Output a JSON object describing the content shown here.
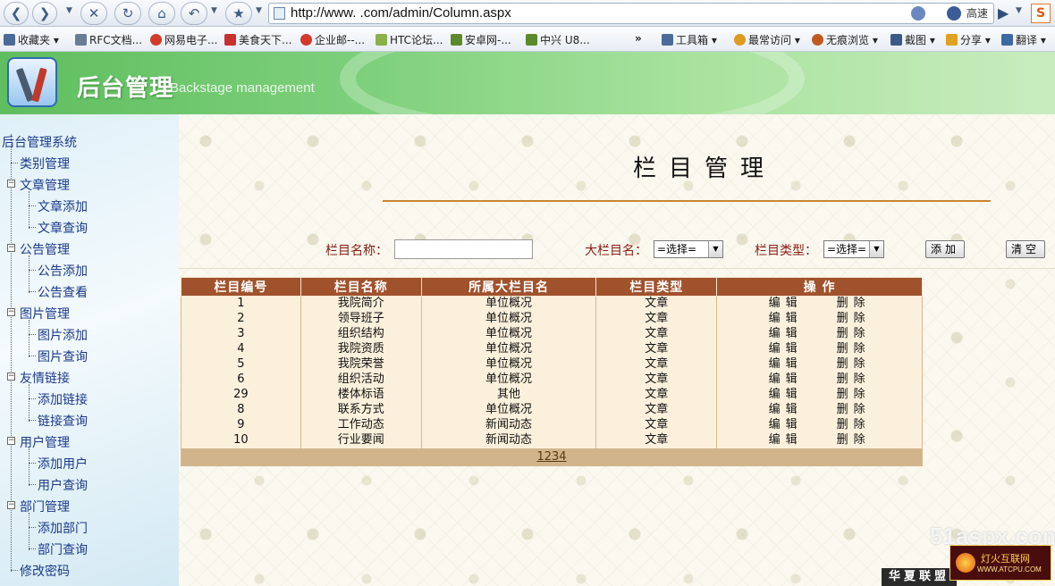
{
  "browser": {
    "url": "http://www.          .com/admin/Column.aspx",
    "speed_label": "高速",
    "bookmarks": [
      {
        "label": "收藏夹",
        "color": "#4a6a9a"
      },
      {
        "label": "RFC文档...",
        "color": "#6a7c94"
      },
      {
        "label": "网易电子...",
        "color": "#d23a2a"
      },
      {
        "label": "美食天下...",
        "color": "#c83030"
      },
      {
        "label": "企业邮--...",
        "color": "#d23a2a"
      },
      {
        "label": "HTC论坛...",
        "color": "#8ab04a"
      },
      {
        "label": "安卓网-...",
        "color": "#5b8a2a"
      },
      {
        "label": "中兴 U8...",
        "color": "#5b8a2a"
      },
      {
        "label": "工具箱",
        "color": "#4a6a9a"
      },
      {
        "label": "最常访问",
        "color": "#e09a20"
      },
      {
        "label": "无痕浏览",
        "color": "#c05a20"
      },
      {
        "label": "截图",
        "color": "#3a5a8a"
      },
      {
        "label": "分享",
        "color": "#e0a020"
      },
      {
        "label": "翻译",
        "color": "#3a6aa0"
      }
    ],
    "overflow_label": "»"
  },
  "banner": {
    "title": "后台管理",
    "subtitle": "Backstage management"
  },
  "sidebar": {
    "root": "后台管理系统",
    "items": [
      {
        "label": "类别管理",
        "level": 1
      },
      {
        "label": "文章管理",
        "level": 1,
        "expand": true
      },
      {
        "label": "文章添加",
        "level": 2
      },
      {
        "label": "文章查询",
        "level": 2
      },
      {
        "label": "公告管理",
        "level": 1,
        "expand": true
      },
      {
        "label": "公告添加",
        "level": 2
      },
      {
        "label": "公告查看",
        "level": 2
      },
      {
        "label": "图片管理",
        "level": 1,
        "expand": true
      },
      {
        "label": "图片添加",
        "level": 2
      },
      {
        "label": "图片查询",
        "level": 2
      },
      {
        "label": "友情链接",
        "level": 1,
        "expand": true
      },
      {
        "label": "添加链接",
        "level": 2
      },
      {
        "label": "链接查询",
        "level": 2
      },
      {
        "label": "用户管理",
        "level": 1,
        "expand": true
      },
      {
        "label": "添加用户",
        "level": 2
      },
      {
        "label": "用户查询",
        "level": 2
      },
      {
        "label": "部门管理",
        "level": 1,
        "expand": true
      },
      {
        "label": "添加部门",
        "level": 2
      },
      {
        "label": "部门查询",
        "level": 2
      },
      {
        "label": "修改密码",
        "level": 1
      }
    ]
  },
  "main": {
    "title": "栏目管理",
    "form": {
      "name_label": "栏目名称：",
      "name_value": "",
      "parent_label": "大栏目名：",
      "parent_value": "=选择=",
      "type_label": "栏目类型：",
      "type_value": "=选择=",
      "add_button": "添加",
      "clear_button": "清空"
    },
    "table": {
      "headers": [
        "栏目编号",
        "栏目名称",
        "所属大栏目名",
        "栏目类型",
        "操 作"
      ],
      "edit_label": "编辑",
      "delete_label": "删除",
      "rows": [
        [
          "1",
          "我院简介",
          "单位概况",
          "文章"
        ],
        [
          "2",
          "领导班子",
          "单位概况",
          "文章"
        ],
        [
          "3",
          "组织结构",
          "单位概况",
          "文章"
        ],
        [
          "4",
          "我院资质",
          "单位概况",
          "文章"
        ],
        [
          "5",
          "我院荣誉",
          "单位概况",
          "文章"
        ],
        [
          "6",
          "组织活动",
          "单位概况",
          "文章"
        ],
        [
          "29",
          "楼体标语",
          "其他",
          "文章"
        ],
        [
          "8",
          "联系方式",
          "单位概况",
          "文章"
        ],
        [
          "9",
          "工作动态",
          "新闻动态",
          "文章"
        ],
        [
          "10",
          "行业要闻",
          "新闻动态",
          "文章"
        ]
      ],
      "pages": [
        "1",
        "2",
        "3",
        "4"
      ]
    }
  },
  "watermarks": {
    "site_51": "51aspx.com",
    "huaxia": "华夏联盟",
    "fire_name": "灯火互联网",
    "fire_url": "WWW.ATCPU.COM"
  }
}
